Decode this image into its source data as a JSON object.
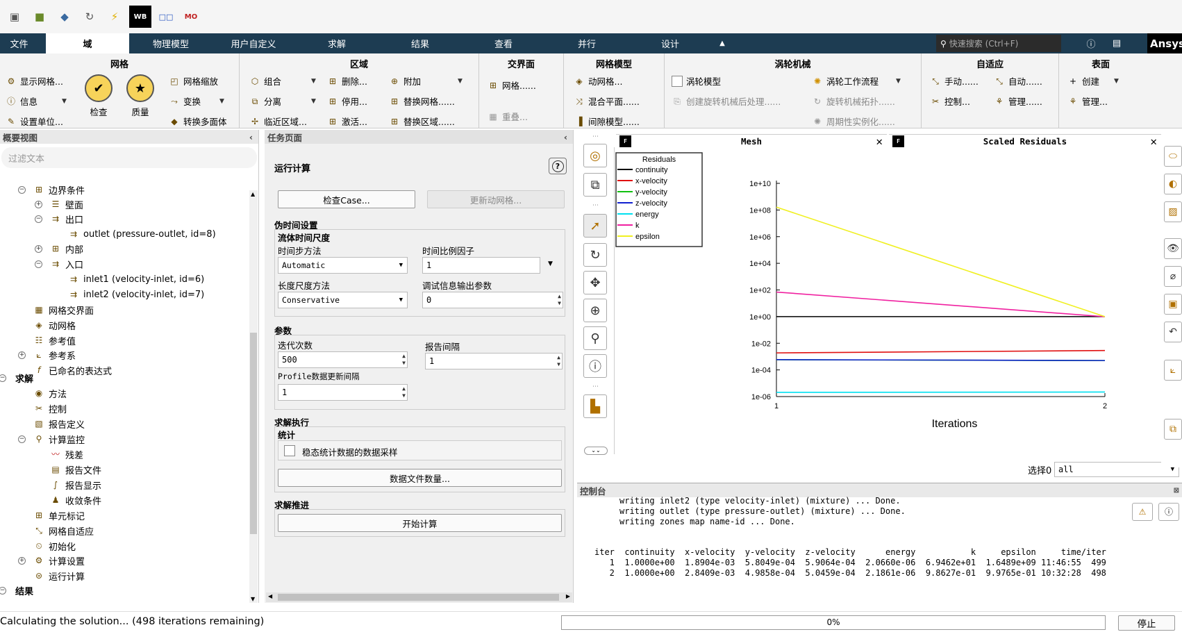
{
  "quickbar": {
    "icons": [
      "open-file-icon",
      "save-icon",
      "mesh-icon",
      "refresh-icon",
      "lightning-icon",
      "workbench-icon",
      "compare-icon",
      "mosaic-icon"
    ],
    "wb_label": "WB",
    "m1": "□□",
    "m2": "MO"
  },
  "menu": {
    "tabs": [
      "文件",
      "域",
      "物理模型",
      "用户自定义",
      "求解",
      "结果",
      "查看",
      "并行",
      "设计"
    ],
    "search_placeholder": "快速搜索 (Ctrl+F)",
    "brand": "Ansys"
  },
  "ribbon": {
    "mesh": {
      "title": "网格",
      "display": "显示网格...",
      "info": "信息",
      "units": "设置单位...",
      "check": "检查",
      "quality": "质量",
      "scale": "网格缩放",
      "transform": "变换",
      "polyhedra": "转换多面体"
    },
    "zones": {
      "title": "区域",
      "combine": "组合",
      "separate": "分离",
      "adjacency": "临近区域...",
      "delete": "删除...",
      "deactivate": "停用...",
      "activate": "激活...",
      "append": "附加",
      "replace_mesh": "替换网格......",
      "replace_zone": "替换区域......"
    },
    "interface": {
      "title": "交界面",
      "mesh": "网格......",
      "overlap": "重叠..."
    },
    "mesh_models": {
      "title": "网格模型",
      "dynamic": "动网格...",
      "mixing": "混合平面......",
      "gap": "间隙模型......"
    },
    "turbo": {
      "title": "涡轮机械",
      "model": "涡轮模型",
      "workflow": "涡轮工作流程",
      "post": "创建旋转机械后处理......",
      "topology": "旋转机械拓扑......",
      "periodic": "周期性实例化......"
    },
    "adapt": {
      "title": "自适应",
      "manual": "手动......",
      "auto": "自动......",
      "control": "控制...",
      "manage": "管理......"
    },
    "surface": {
      "title": "表面",
      "create": "创建",
      "manage": "管理..."
    }
  },
  "outline": {
    "title": "概要视图",
    "filter_placeholder": "过滤文本",
    "nodes": [
      "边界条件",
      "壁面",
      "出口",
      "outlet (pressure-outlet, id=8)",
      "内部",
      "入口",
      "inlet1 (velocity-inlet, id=6)",
      "inlet2 (velocity-inlet, id=7)",
      "网格交界面",
      "动网格",
      "参考值",
      "参考系",
      "已命名的表达式",
      "求解",
      "方法",
      "控制",
      "报告定义",
      "计算监控",
      "残差",
      "报告文件",
      "报告显示",
      "收敛条件",
      "单元标记",
      "网格自适应",
      "初始化",
      "计算设置",
      "运行计算",
      "结果"
    ]
  },
  "task": {
    "title": "任务页面",
    "heading": "运行计算",
    "check_case": "检查Case...",
    "update_mesh": "更新动网格...",
    "pseudo_title": "伪时间设置",
    "fluid_time_scale": "流体时间尺度",
    "ts_method_label": "时间步方法",
    "ts_method_value": "Automatic",
    "ts_factor_label": "时间比例因子",
    "ts_factor_value": "1",
    "length_scale_label": "长度尺度方法",
    "length_scale_value": "Conservative",
    "verbosity_label": "调试信息输出参数",
    "verbosity_value": "0",
    "params_title": "参数",
    "iter_label": "迭代次数",
    "iter_value": "500",
    "report_interval_label": "报告间隔",
    "report_interval_value": "1",
    "profile_label": "Profile数据更新间隔",
    "profile_value": "1",
    "exec_title": "求解执行",
    "stats_title": "统计",
    "stats_chk": "稳态统计数据的数据采样",
    "data_files": "数据文件数量...",
    "advance_title": "求解推进",
    "start": "开始计算"
  },
  "graphics": {
    "tab_mesh": "Mesh",
    "tab_residuals": "Scaled Residuals",
    "select_label": "选择0",
    "select_value": "all",
    "f_badge": "F"
  },
  "chart_data": {
    "type": "line",
    "xlabel": "Iterations",
    "x": [
      1,
      2
    ],
    "xticks": [
      "1",
      "2"
    ],
    "yscale": "log",
    "ylim": [
      1e-06,
      10000000000.0
    ],
    "yticks": [
      "1e+10",
      "1e+08",
      "1e+06",
      "1e+04",
      "1e+02",
      "1e+00",
      "1e-02",
      "1e-04",
      "1e-06"
    ],
    "legend_title": "Residuals",
    "legend_position": "top-left",
    "series": [
      {
        "name": "continuity",
        "color": "#000000",
        "values": [
          1.0,
          1.0
        ]
      },
      {
        "name": "x-velocity",
        "color": "#e01010",
        "values": [
          0.0018904,
          0.0028409
        ]
      },
      {
        "name": "y-velocity",
        "color": "#10c010",
        "values": [
          0.00058049,
          0.00049858
        ]
      },
      {
        "name": "z-velocity",
        "color": "#1020d0",
        "values": [
          0.00059064,
          0.00050459
        ]
      },
      {
        "name": "energy",
        "color": "#00e0f0",
        "values": [
          2.066e-06,
          2.1861e-06
        ]
      },
      {
        "name": "k",
        "color": "#f020a0",
        "values": [
          69.462,
          0.98627
        ]
      },
      {
        "name": "epsilon",
        "color": "#f0f020",
        "values": [
          164890000,
          0.99765
        ]
      }
    ]
  },
  "console": {
    "title": "控制台",
    "lines": [
      "writing inlet2 (type velocity-inlet) (mixture) ... Done.",
      "writing outlet (type pressure-outlet) (mixture) ... Done.",
      "writing zones map name-id ... Done."
    ],
    "table_header": "iter  continuity  x-velocity  y-velocity  z-velocity      energy           k     epsilon     time/iter",
    "rows": [
      "   1  1.0000e+00  1.8904e-03  5.8049e-04  5.9064e-04  2.0660e-06  6.9462e+01  1.6489e+09 11:46:55  499",
      "   2  1.0000e+00  2.8409e-03  4.9858e-04  5.0459e-04  2.1861e-06  9.8627e-01  9.9765e-01 10:32:28  498"
    ]
  },
  "status": {
    "message": "Calculating the solution... (498 iterations remaining)",
    "progress_text": "0%",
    "progress": 0.0,
    "stop": "停止"
  }
}
